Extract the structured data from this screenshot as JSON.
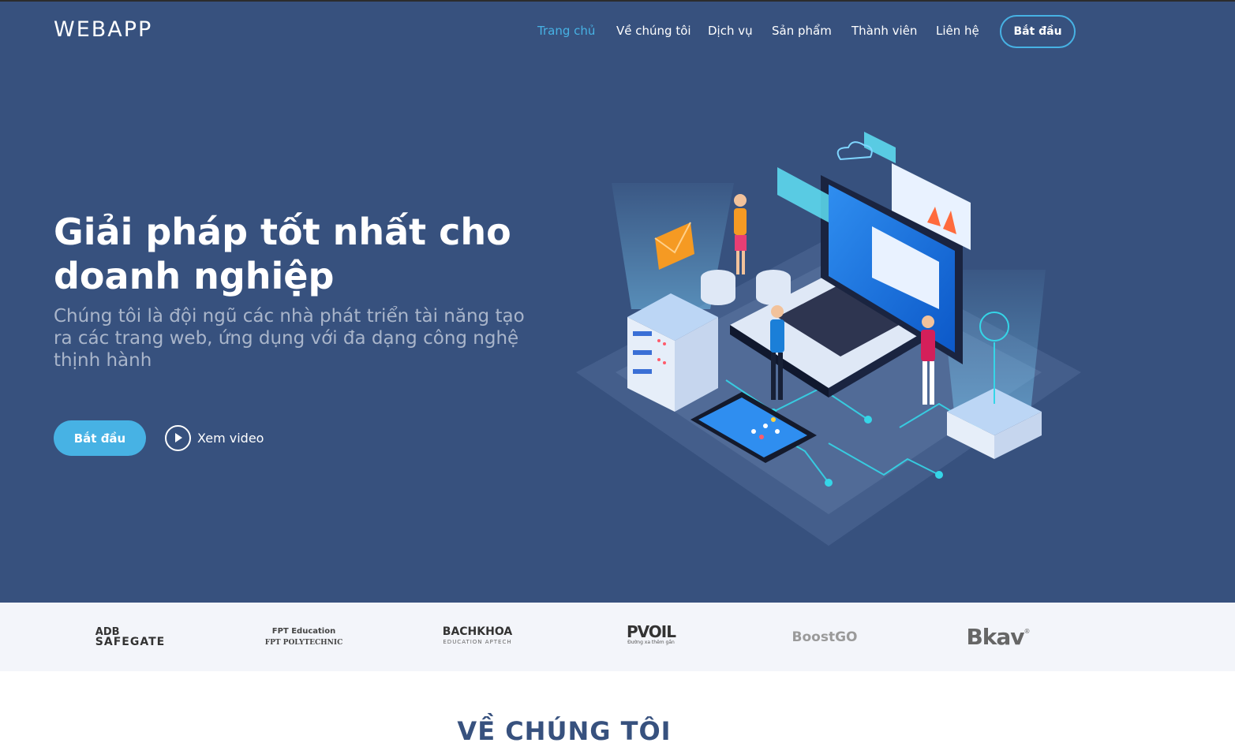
{
  "header": {
    "brand": "WEBAPP",
    "nav": [
      {
        "label": "Trang chủ",
        "active": true
      },
      {
        "label": "Về chúng tôi",
        "active": false
      },
      {
        "label": "Dịch vụ",
        "active": false
      },
      {
        "label": "Sản phẩm",
        "active": false
      },
      {
        "label": "Thành viên",
        "active": false
      },
      {
        "label": "Liên hệ",
        "active": false
      }
    ],
    "cta_label": "Bắt đầu"
  },
  "hero": {
    "title_line1": "Giải pháp tốt nhất cho",
    "title_line2": "doanh nghiệp",
    "subtitle": "Chúng tôi là đội ngũ các nhà phát triển tài năng tạo ra các trang web, ứng dụng với đa dạng công nghệ thịnh hành",
    "start_label": "Bắt đầu",
    "video_label": "Xem video"
  },
  "clients": [
    {
      "name": "ADB SAFEGATE",
      "line1": "ADB",
      "line2": "SAFEGATE"
    },
    {
      "name": "FPT Polytechnic",
      "line1": "FPT Education",
      "line2": "FPT POLYTECHNIC"
    },
    {
      "name": "Bachkhoa Aptech",
      "line1": "BACHKHOA",
      "line2": "EDUCATION APTECH"
    },
    {
      "name": "PVOIL",
      "line1": "PVOIL",
      "line2": "Đường xa thêm gần"
    },
    {
      "name": "BoostGO",
      "line1": "BoostGO",
      "line2": ""
    },
    {
      "name": "Bkav",
      "line1": "Bkav",
      "line2": "®"
    }
  ],
  "about": {
    "title": "VỀ CHÚNG TÔI"
  },
  "colors": {
    "hero_bg": "#37517e",
    "accent": "#47b2e4",
    "clients_bg": "#f3f5fa"
  }
}
